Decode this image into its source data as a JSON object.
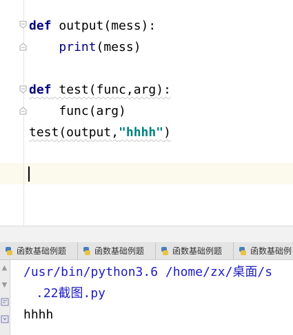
{
  "editor": {
    "lines": [
      {
        "id": "l1",
        "kw": "def",
        "rest": " output(mess):"
      },
      {
        "id": "l2",
        "indent": "    ",
        "builtin": "print",
        "rest": "(mess)"
      },
      {
        "id": "l3",
        "kw": "def",
        "rest": " test(func,arg):"
      },
      {
        "id": "l4",
        "indent": "    ",
        "plain": "func(arg)"
      },
      {
        "id": "l5",
        "plain": "test(output,",
        "str": "\"hhhh\"",
        "after": ")"
      }
    ]
  },
  "tabs": [
    {
      "label": "函数基础例题"
    },
    {
      "label": "函数基础例题"
    },
    {
      "label": "函数基础例题"
    },
    {
      "label": "函数基础例"
    }
  ],
  "console": {
    "lines": [
      "/usr/bin/python3.6 /home/zx/桌面/s",
      ".22截图.py",
      "hhhh"
    ]
  },
  "colors": {
    "keyword": "#000080",
    "string": "#008080",
    "console_path": "#1d1dc4",
    "caret_row": "#fcfaed"
  }
}
